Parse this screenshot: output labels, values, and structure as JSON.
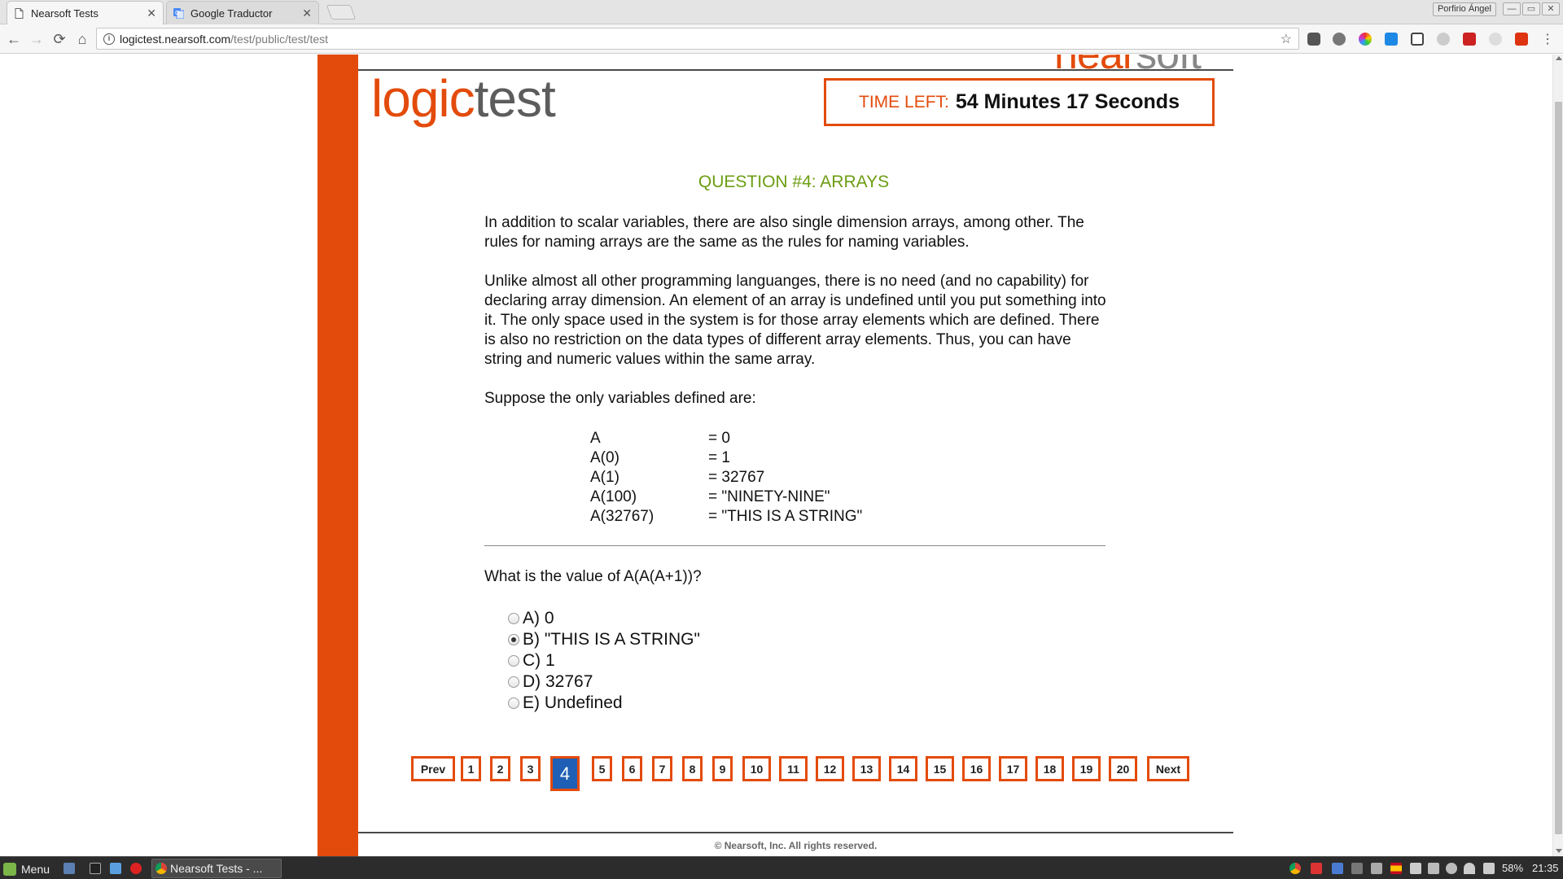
{
  "browser": {
    "tabs": [
      {
        "title": "Nearsoft Tests",
        "active": true
      },
      {
        "title": "Google Traductor",
        "active": false
      }
    ],
    "profile": "Porfirio Ángel",
    "url_host": "logictest.nearsoft.com",
    "url_path": "/test/public/test/test",
    "info_glyph": "i",
    "star_glyph": "☆",
    "nav": {
      "back": "←",
      "forward": "→",
      "reload": "⟳",
      "home": "⌂"
    },
    "window_controls": [
      "—",
      "▭",
      "✕"
    ]
  },
  "page": {
    "brand_top": {
      "near": "near",
      "soft": "soft"
    },
    "logo": {
      "logic": "logic",
      "test": "test"
    },
    "timer": {
      "label": "TIME LEFT:",
      "value": "54 Minutes 17 Seconds"
    },
    "question_title": "QUESTION #4: ARRAYS",
    "paragraphs": [
      "In addition to scalar variables, there are also single dimension arrays, among other. The rules for naming arrays are the same as the rules for naming variables.",
      "Unlike almost all other programming languanges, there is no need (and no capability) for declaring array dimension. An element of an array is undefined until you put something into it. The only space used in the system is for those array elements which are defined. There is also no restriction on the data types of different array elements. Thus, you can have string and numeric values within the same array.",
      "Suppose the only variables defined are:"
    ],
    "variables": [
      {
        "name": "A",
        "value": "= 0"
      },
      {
        "name": "A(0)",
        "value": "= 1"
      },
      {
        "name": "A(1)",
        "value": "= 32767"
      },
      {
        "name": "A(100)",
        "value": "= \"NINETY-NINE\""
      },
      {
        "name": "A(32767)",
        "value": "= \"THIS IS A STRING\""
      }
    ],
    "question": "What is the value of A(A(A+1))?",
    "options": [
      {
        "label": "A) 0",
        "checked": false
      },
      {
        "label": "B) \"THIS IS A STRING\"",
        "checked": true
      },
      {
        "label": "C) 1",
        "checked": false
      },
      {
        "label": "D) 32767",
        "checked": false
      },
      {
        "label": "E) Undefined",
        "checked": false
      }
    ],
    "pager": {
      "prev": "Prev",
      "next": "Next",
      "pages": [
        "1",
        "2",
        "3",
        "4",
        "5",
        "6",
        "7",
        "8",
        "9",
        "10",
        "11",
        "12",
        "13",
        "14",
        "15",
        "16",
        "17",
        "18",
        "19",
        "20"
      ],
      "current": "4"
    },
    "footer": "© Nearsoft, Inc.  All rights reserved."
  },
  "taskbar": {
    "menu": "Menu",
    "task": "Nearsoft Tests - ...",
    "battery": "58%",
    "clock": "21:35"
  },
  "colors": {
    "accent": "#e34b0c",
    "title_green": "#6c9d12",
    "current_page": "#1f5fb5"
  }
}
